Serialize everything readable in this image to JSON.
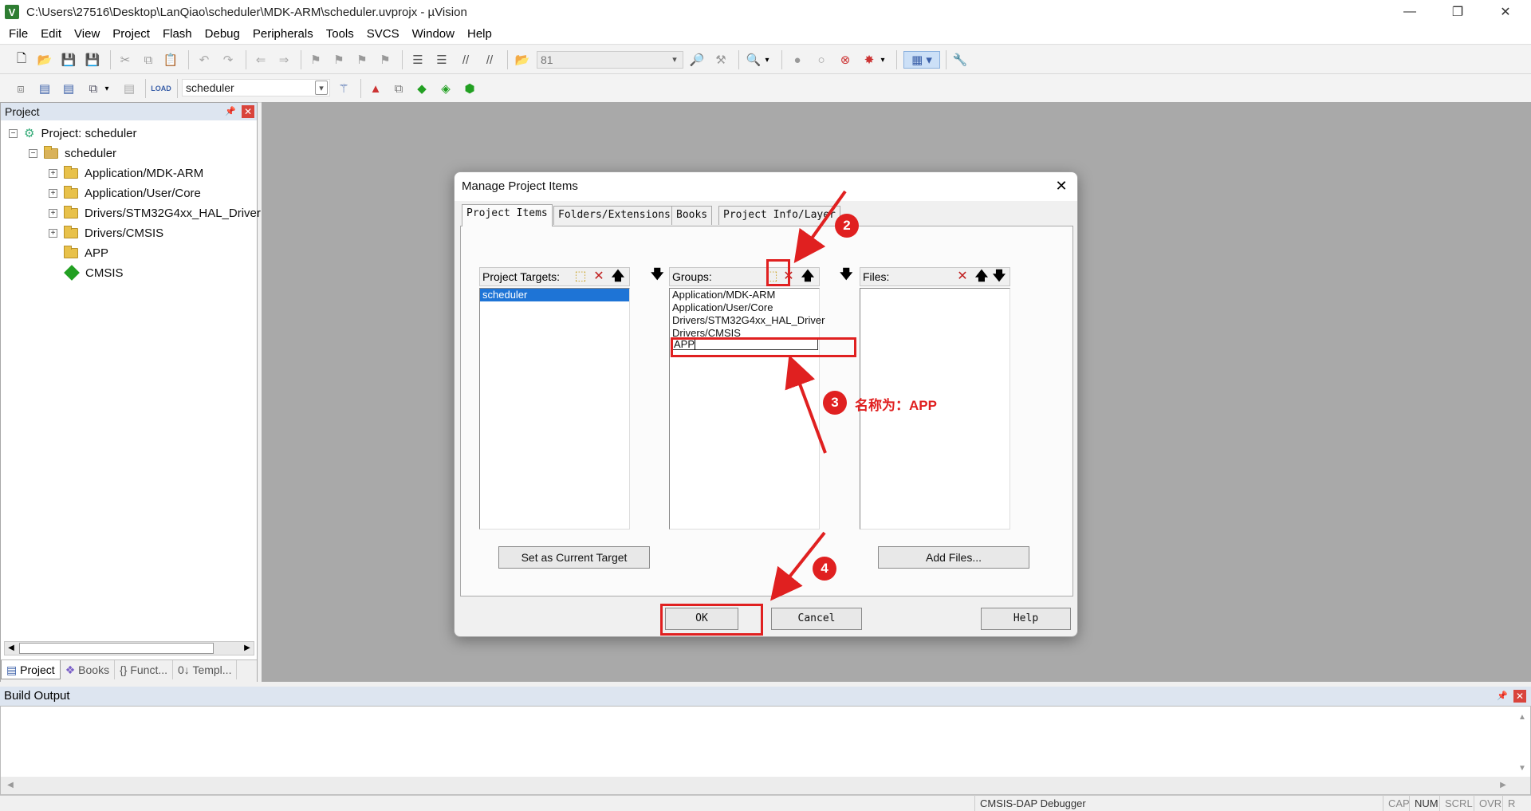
{
  "window": {
    "title": "C:\\Users\\27516\\Desktop\\LanQiao\\scheduler\\MDK-ARM\\scheduler.uvprojx - µVision",
    "app_icon": "V",
    "minimize_glyph": "—",
    "maximize_glyph": "❐",
    "close_glyph": "✕"
  },
  "menu": [
    "File",
    "Edit",
    "View",
    "Project",
    "Flash",
    "Debug",
    "Peripherals",
    "Tools",
    "SVCS",
    "Window",
    "Help"
  ],
  "toolbar1": {
    "find_combo_value": "81"
  },
  "toolbar2": {
    "target_combo_value": "scheduler"
  },
  "project_pane": {
    "title": "Project",
    "tree": [
      {
        "label": "Project: scheduler",
        "icon": "project-root-icon"
      },
      {
        "label": "scheduler",
        "icon": "target-icon"
      },
      {
        "label": "Application/MDK-ARM",
        "icon": "folder-icon"
      },
      {
        "label": "Application/User/Core",
        "icon": "folder-icon"
      },
      {
        "label": "Drivers/STM32G4xx_HAL_Driver",
        "icon": "folder-icon"
      },
      {
        "label": "Drivers/CMSIS",
        "icon": "folder-icon"
      },
      {
        "label": "APP",
        "icon": "folder-icon"
      },
      {
        "label": "CMSIS",
        "icon": "cmsis-icon"
      }
    ],
    "tabs": [
      "Project",
      "Books",
      "{} Funct...",
      "0↓ Templ..."
    ]
  },
  "build_output": {
    "title": "Build Output"
  },
  "status_bar": {
    "debugger": "CMSIS-DAP Debugger",
    "caps": "CAP",
    "num": "NUM",
    "scrl": "SCRL",
    "ovr": "OVR",
    "rw": "R /W"
  },
  "dialog": {
    "title": "Manage Project Items",
    "tabs": [
      "Project Items",
      "Folders/Extensions",
      "Books",
      "Project Info/Layer"
    ],
    "targets": {
      "header": "Project Targets:",
      "items": [
        "scheduler"
      ]
    },
    "groups": {
      "header": "Groups:",
      "items": [
        "Application/MDK-ARM",
        "Application/User/Core",
        "Drivers/STM32G4xx_HAL_Driver",
        "Drivers/CMSIS"
      ],
      "editing_value": "APP"
    },
    "files": {
      "header": "Files:",
      "items": []
    },
    "set_current_target_label": "Set as Current Target",
    "add_files_label": "Add Files...",
    "ok_label": "OK",
    "cancel_label": "Cancel",
    "help_label": "Help"
  },
  "annotations": {
    "step2": "2",
    "step3": "3",
    "step3_text": "名称为：APP",
    "step4": "4",
    "color": "#e02020"
  }
}
